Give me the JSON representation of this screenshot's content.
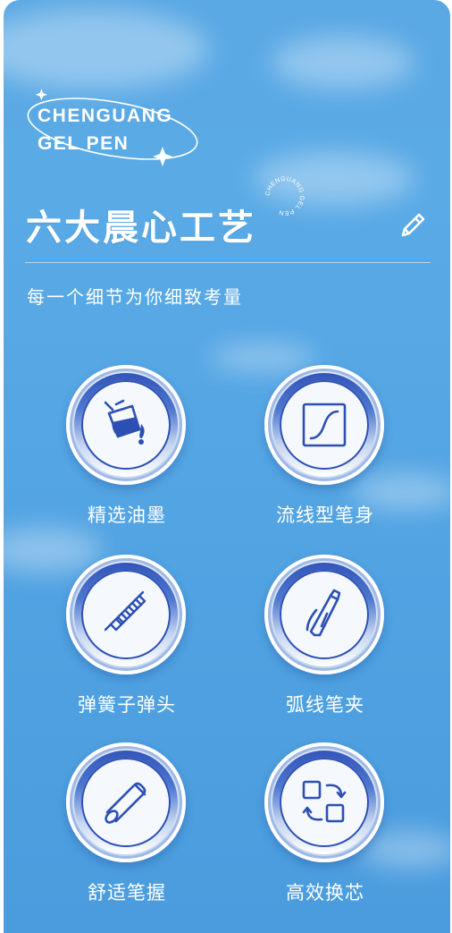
{
  "logo": {
    "line1": "CHENGUANG",
    "line2": "GEL PEN"
  },
  "header": {
    "title": "六大晨心工艺",
    "badge_text": "CHENGUANG GEL PEN",
    "subtitle": "每一个细节为你细致考量"
  },
  "features": [
    {
      "label": "精选油墨",
      "icon": "ink-bucket-icon"
    },
    {
      "label": "流线型笔身",
      "icon": "curve-icon"
    },
    {
      "label": "弹簧子弹头",
      "icon": "spring-tip-icon"
    },
    {
      "label": "弧线笔夹",
      "icon": "pen-clip-icon"
    },
    {
      "label": "舒适笔握",
      "icon": "grip-cylinder-icon"
    },
    {
      "label": "高效换芯",
      "icon": "refill-swap-icon"
    }
  ],
  "colors": {
    "background": "#55a6e4",
    "icon_blue": "#2c4fb3",
    "text": "#ffffff"
  }
}
